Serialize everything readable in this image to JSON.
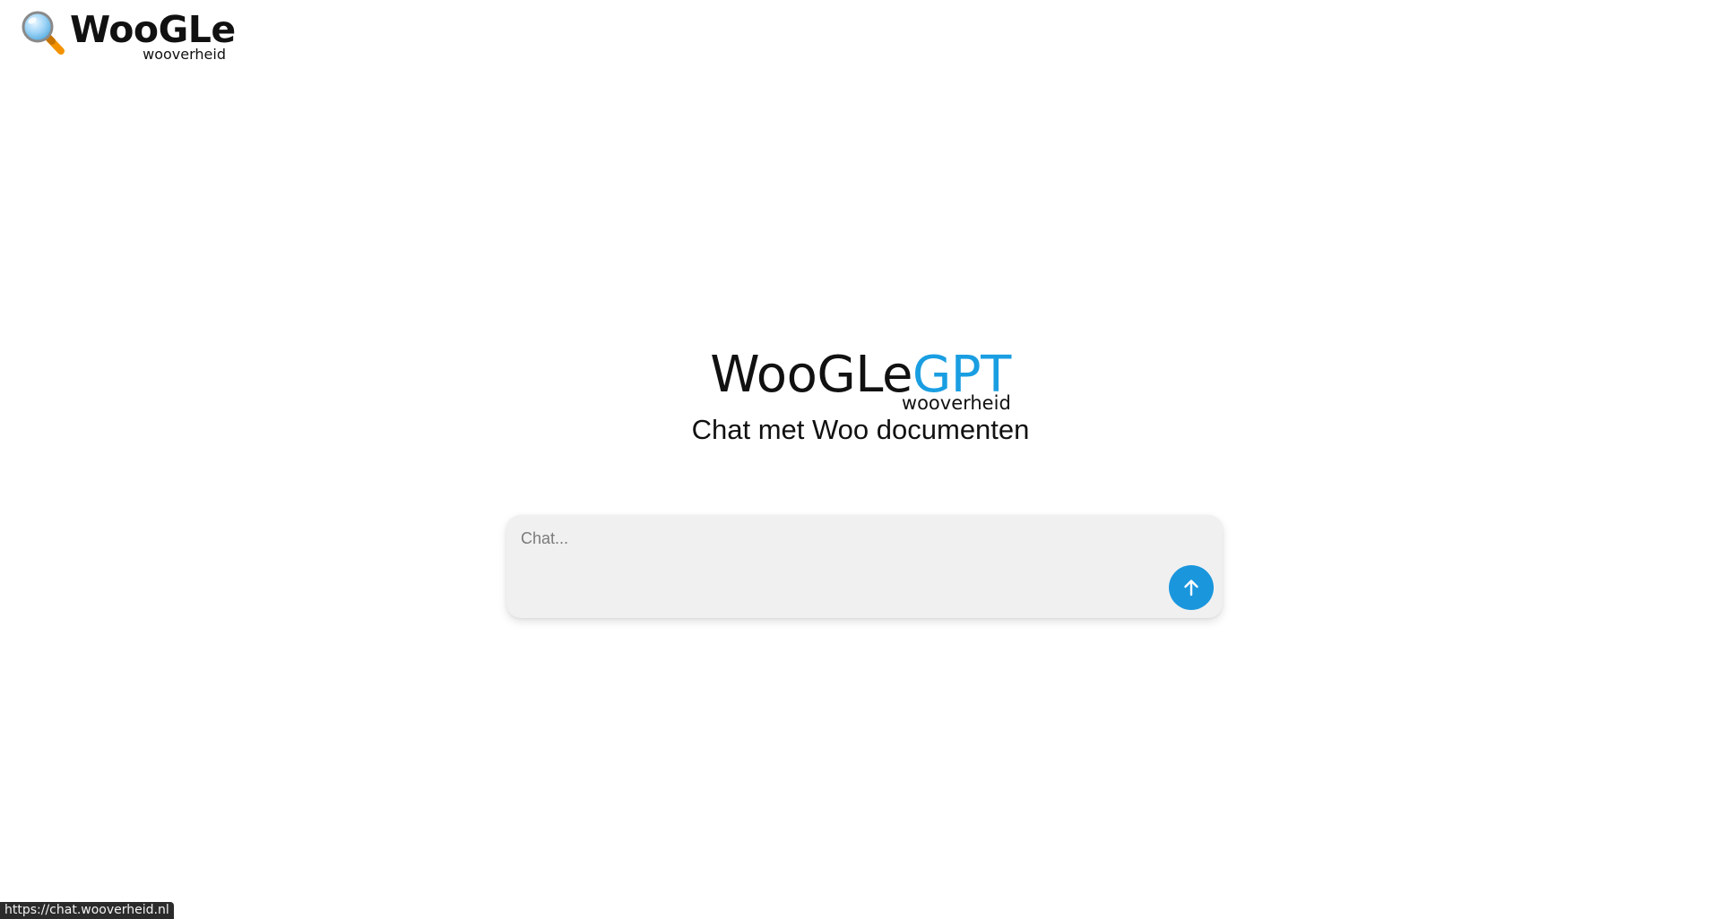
{
  "header": {
    "brand_name": "WooGLe",
    "brand_sub": "wooverheid",
    "icon": "magnifier-icon"
  },
  "hero": {
    "name_part1": "WooGLe",
    "name_part2": "GPT",
    "sub": "wooverheid",
    "tagline": "Chat met Woo documenten"
  },
  "chat": {
    "placeholder": "Chat...",
    "value": "",
    "send_icon": "arrow-up-icon"
  },
  "status_bar": {
    "url": "https://chat.wooverheid.nl"
  },
  "colors": {
    "accent": "#1a9ee2",
    "send_button": "#1a96dd",
    "chat_bg": "#f0f0f0",
    "text": "#111111"
  }
}
